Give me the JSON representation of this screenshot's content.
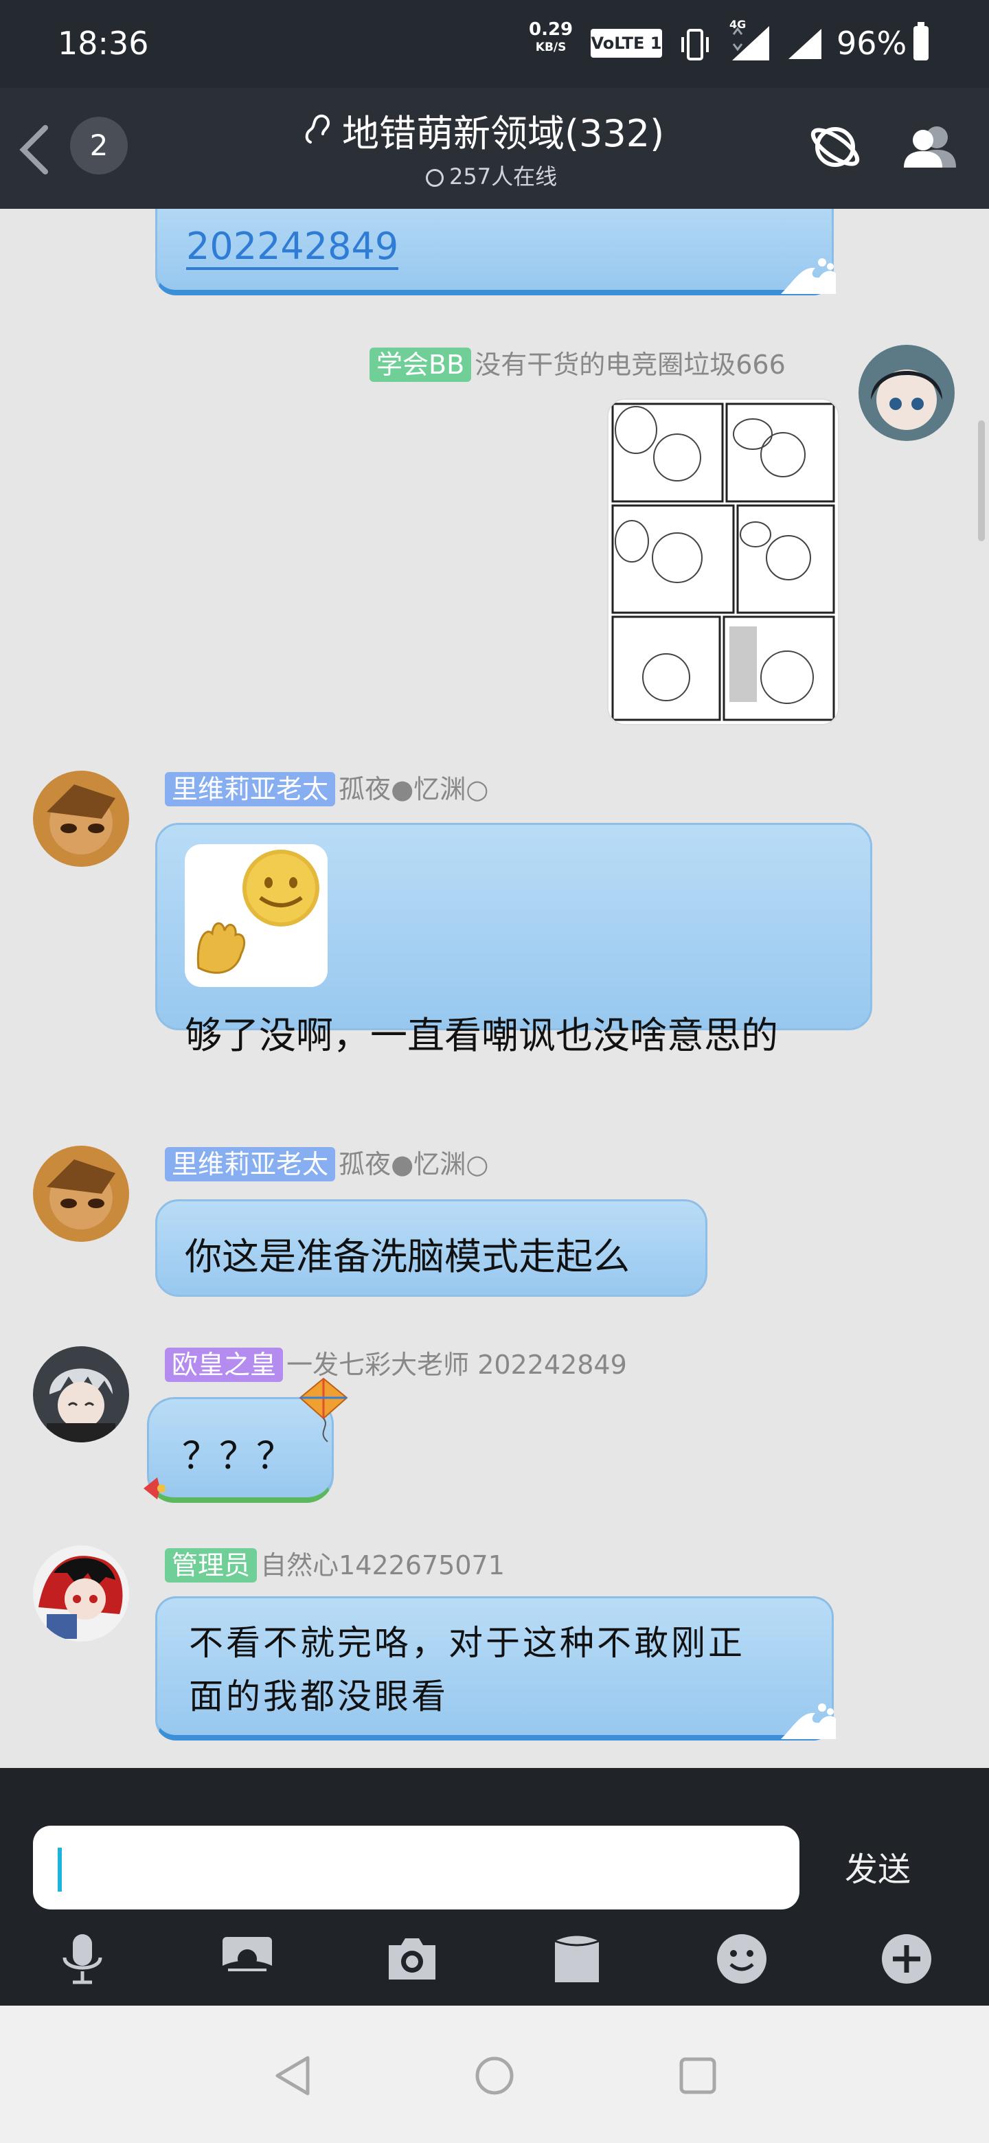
{
  "status_bar": {
    "time": "18:36",
    "net_speed": "0.29",
    "net_speed_unit": "KB/S",
    "volte": "VoLTE 1",
    "network": "4G",
    "battery": "96%"
  },
  "header": {
    "unread_count": "2",
    "title": "地错萌新领域(332)",
    "online": "257人在线"
  },
  "messages": {
    "m0": {
      "text": "202242849"
    },
    "m1": {
      "tag": "学会BB",
      "tag_color": "#6fcf97",
      "nick": "没有干货的电竞圈垃圾666"
    },
    "m2": {
      "tag": "里维莉亚老太",
      "tag_color": "#86aef0",
      "nick": "孤夜●忆渊○",
      "text": "够了没啊，一直看嘲讽也没啥意思的"
    },
    "m3": {
      "tag": "里维莉亚老太",
      "tag_color": "#86aef0",
      "nick": "孤夜●忆渊○",
      "text": "你这是准备洗脑模式走起么"
    },
    "m4": {
      "tag": "欧皇之皇",
      "tag_color": "#b48cf0",
      "nick": "一发七彩大老师 202242849",
      "text": "？？？"
    },
    "m5": {
      "tag": "管理员",
      "tag_color": "#6fcf97",
      "nick": "自然心1422675071",
      "text_line1": "不看不就完咯，对于这种不敢刚正",
      "text_line2": "面的我都没眼看"
    }
  },
  "input": {
    "placeholder": "",
    "send_label": "发送"
  },
  "toolbar": {
    "icons": [
      "microphone-icon",
      "image-icon",
      "camera-icon",
      "file-icon",
      "emoji-icon",
      "plus-icon"
    ]
  },
  "nav": {
    "icons": [
      "back-triangle-icon",
      "home-circle-icon",
      "recents-square-icon"
    ]
  }
}
